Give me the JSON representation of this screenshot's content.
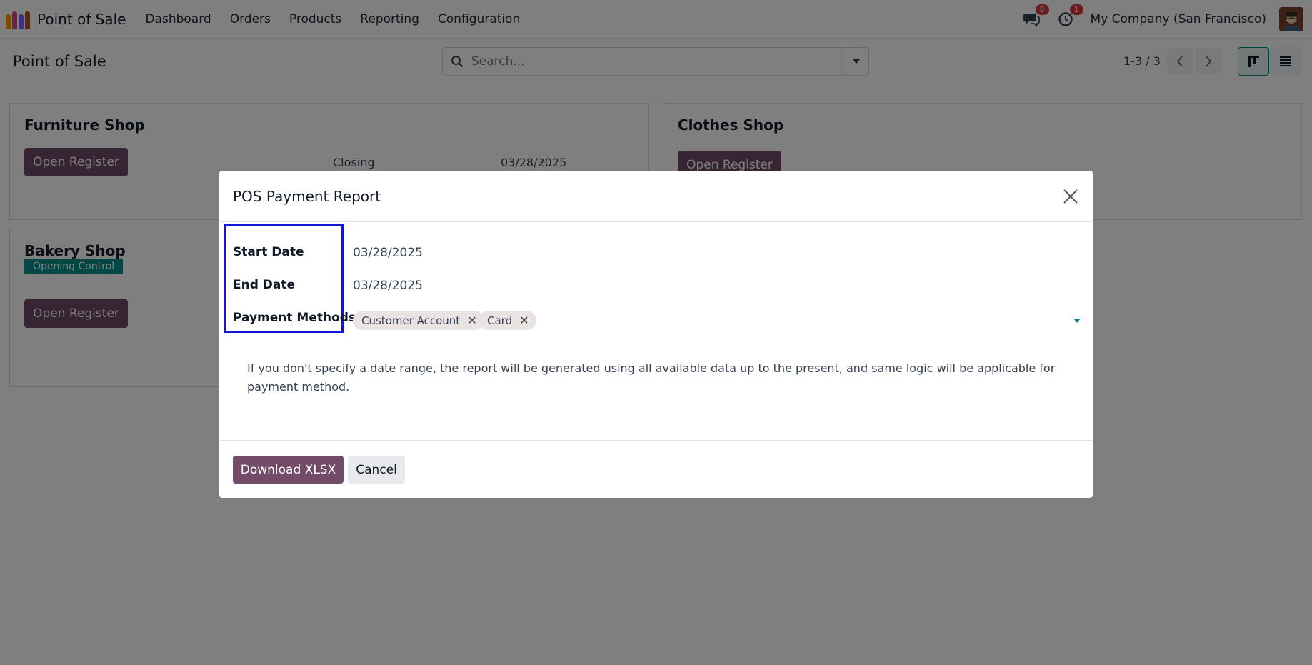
{
  "navbar": {
    "app_title": "Point of Sale",
    "menu": [
      "Dashboard",
      "Orders",
      "Products",
      "Reporting",
      "Configuration"
    ],
    "messages_count": "8",
    "activities_count": "1",
    "company": "My Company (San Francisco)"
  },
  "control_panel": {
    "title": "Point of Sale",
    "search_placeholder": "Search...",
    "pager": "1-3 / 3"
  },
  "kanban": {
    "cards": [
      {
        "name": "Furniture Shop",
        "button": "Open Register",
        "closing_label": "Closing",
        "closing_date": "03/28/2025"
      },
      {
        "name": "Clothes Shop",
        "button": "Open Register"
      },
      {
        "name": "Bakery Shop",
        "status": "Opening Control",
        "button": "Open Register"
      }
    ]
  },
  "modal": {
    "title": "POS Payment Report",
    "fields": {
      "start_date_label": "Start Date",
      "start_date_value": "03/28/2025",
      "end_date_label": "End Date",
      "end_date_value": "03/28/2025",
      "payment_methods_label": "Payment Methods",
      "payment_methods": [
        "Customer Account",
        "Card"
      ]
    },
    "help_text": "If you don't specify a date range, the report will be generated using all available data up to the present, and same logic will be applicable for payment method.",
    "buttons": {
      "download": "Download XLSX",
      "cancel": "Cancel"
    }
  },
  "colors": {
    "primary": "#714b67",
    "accent": "#017e84",
    "highlight_box": "#1414d6",
    "badge": "#d63a3a",
    "opening_tag": "#008f8c"
  }
}
